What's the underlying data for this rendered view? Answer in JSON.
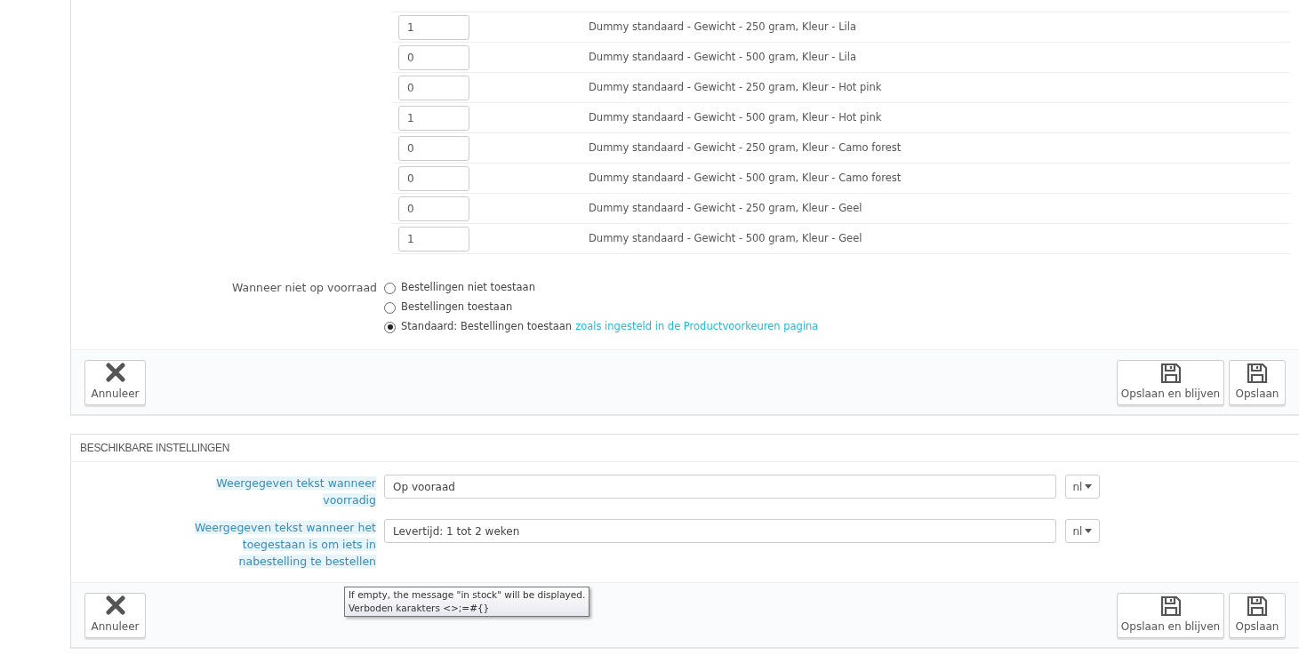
{
  "stock_rows": [
    {
      "quantity": "1",
      "combination": "Dummy standaard - Gewicht - 250 gram, Kleur - Lila"
    },
    {
      "quantity": "0",
      "combination": "Dummy standaard - Gewicht - 500 gram, Kleur - Lila"
    },
    {
      "quantity": "0",
      "combination": "Dummy standaard - Gewicht - 250 gram, Kleur - Hot pink"
    },
    {
      "quantity": "1",
      "combination": "Dummy standaard - Gewicht - 500 gram, Kleur - Hot pink"
    },
    {
      "quantity": "0",
      "combination": "Dummy standaard - Gewicht - 250 gram, Kleur - Camo forest"
    },
    {
      "quantity": "0",
      "combination": "Dummy standaard - Gewicht - 500 gram, Kleur - Camo forest"
    },
    {
      "quantity": "0",
      "combination": "Dummy standaard - Gewicht - 250 gram, Kleur - Geel"
    },
    {
      "quantity": "1",
      "combination": "Dummy standaard - Gewicht - 500 gram, Kleur - Geel"
    }
  ],
  "out_of_stock": {
    "label": "Wanneer niet op voorraad",
    "options": [
      {
        "label": "Bestellingen niet toestaan",
        "selected": false
      },
      {
        "label": "Bestellingen toestaan",
        "selected": false
      },
      {
        "label": "Standaard: Bestellingen toestaan",
        "link": "zoals ingesteld in de Productvoorkeuren pagina",
        "selected": true
      }
    ]
  },
  "footer_1": {
    "cancel": "Annuleer",
    "save_stay": "Opslaan en blijven",
    "save": "Opslaan"
  },
  "availability": {
    "title": "BESCHIKBARE INSTELLINGEN",
    "fields": [
      {
        "label": "Weergegeven tekst wanneer voorradig",
        "value": "Op vooraad",
        "language": "nl"
      },
      {
        "label": "Weergegeven tekst wanneer het toegestaan is om iets in nabestelling te bestellen",
        "value": "Levertijd: 1 tot 2 weken",
        "language": "nl"
      }
    ],
    "tooltip": [
      "If empty, the message \"in stock\" will be displayed.",
      "Verboden karakters <>;=#{}"
    ]
  },
  "footer_2": {
    "cancel": "Annuleer",
    "save_stay": "Opslaan en blijven",
    "save": "Opslaan"
  }
}
